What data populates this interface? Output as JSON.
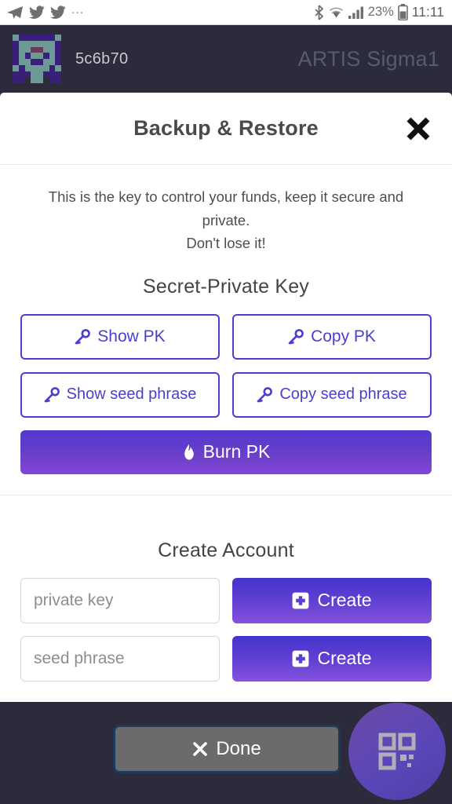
{
  "status_bar": {
    "left_icons": [
      "telegram-send-icon",
      "twitter-bird-icon",
      "twitter-bird-icon"
    ],
    "overflow": "...",
    "right_icons": [
      "bluetooth-icon",
      "wifi-icon",
      "cellular-signal-icon",
      "battery-icon"
    ],
    "battery_percent": "23%",
    "time": "11:11"
  },
  "app_header": {
    "avatar_name": "account-identicon",
    "account_address": "5c6b70",
    "network_name": "ARTIS Sigma1",
    "avatar_colors": {
      "background": "#2b2b3b",
      "dark_purple": "#3a1f7a",
      "teal": "#6d9a96",
      "mauve": "#6b3a5e"
    }
  },
  "modal": {
    "title": "Backup & Restore",
    "close_label": "✕"
  },
  "key_section": {
    "notice_line1": "This is the key to control your funds, keep it secure and private.",
    "notice_line2": "Don't lose it!",
    "heading": "Secret-Private Key",
    "buttons": [
      {
        "label": "Show PK",
        "icon": "key-icon"
      },
      {
        "label": "Copy PK",
        "icon": "key-icon"
      },
      {
        "label": "Show seed phrase",
        "icon": "key-icon"
      },
      {
        "label": "Copy seed phrase",
        "icon": "key-icon"
      }
    ],
    "burn": {
      "label": "Burn PK",
      "icon": "flame-icon"
    }
  },
  "create_section": {
    "heading": "Create Account",
    "rows": [
      {
        "placeholder": "private key",
        "value": "",
        "button_label": "Create",
        "button_icon": "plus-square-icon"
      },
      {
        "placeholder": "seed phrase",
        "value": "",
        "button_label": "Create",
        "button_icon": "plus-square-icon"
      }
    ]
  },
  "bottom_bar": {
    "done_label": "Done",
    "done_icon": "close-x-icon",
    "fab_icon": "qr-code-icon"
  },
  "colors": {
    "accent_indigo": "#4a3fd0",
    "gradient_start": "#4433cc",
    "gradient_end": "#8552dd",
    "app_background": "#2b2b3b",
    "done_fill": "#6b6b6b",
    "done_border": "#1b3a5c"
  }
}
